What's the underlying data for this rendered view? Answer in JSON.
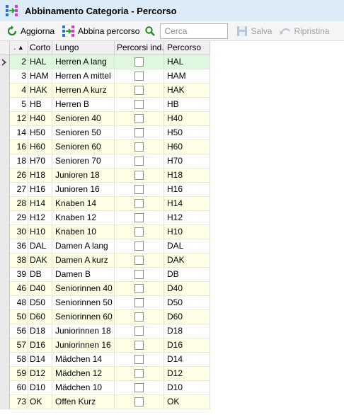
{
  "window": {
    "title": "Abbinamento Categoria - Percorso"
  },
  "toolbar": {
    "refresh_label": "Aggiorna",
    "match_label": "Abbina percorso",
    "search_placeholder": "Cerca",
    "save_label": "Salva",
    "restore_label": "Ripristina"
  },
  "table": {
    "columns": [
      ".",
      "Corto",
      "Lungo",
      "Percorsi ind.",
      "Percorso"
    ],
    "rows": [
      {
        "num": "2",
        "short": "HAL",
        "long": "Herren A lang",
        "percorso": "HAL"
      },
      {
        "num": "3",
        "short": "HAM",
        "long": "Herren A mittel",
        "percorso": "HAM"
      },
      {
        "num": "4",
        "short": "HAK",
        "long": "Herren A kurz",
        "percorso": "HAK"
      },
      {
        "num": "5",
        "short": "HB",
        "long": "Herren B",
        "percorso": "HB"
      },
      {
        "num": "12",
        "short": "H40",
        "long": "Senioren 40",
        "percorso": "H40"
      },
      {
        "num": "14",
        "short": "H50",
        "long": "Senioren 50",
        "percorso": "H50"
      },
      {
        "num": "16",
        "short": "H60",
        "long": "Senioren 60",
        "percorso": "H60"
      },
      {
        "num": "18",
        "short": "H70",
        "long": "Senioren 70",
        "percorso": "H70"
      },
      {
        "num": "26",
        "short": "H18",
        "long": "Junioren 18",
        "percorso": "H18"
      },
      {
        "num": "27",
        "short": "H16",
        "long": "Junioren 16",
        "percorso": "H16"
      },
      {
        "num": "28",
        "short": "H14",
        "long": "Knaben 14",
        "percorso": "H14"
      },
      {
        "num": "29",
        "short": "H12",
        "long": "Knaben 12",
        "percorso": "H12"
      },
      {
        "num": "30",
        "short": "H10",
        "long": "Knaben 10",
        "percorso": "H10"
      },
      {
        "num": "36",
        "short": "DAL",
        "long": "Damen A lang",
        "percorso": "DAL"
      },
      {
        "num": "38",
        "short": "DAK",
        "long": "Damen A kurz",
        "percorso": "DAK"
      },
      {
        "num": "39",
        "short": "DB",
        "long": "Damen B",
        "percorso": "DB"
      },
      {
        "num": "46",
        "short": "D40",
        "long": "Seniorinnen 40",
        "percorso": "D40"
      },
      {
        "num": "48",
        "short": "D50",
        "long": "Seniorinnen 50",
        "percorso": "D50"
      },
      {
        "num": "50",
        "short": "D60",
        "long": "Seniorinnen 60",
        "percorso": "D60"
      },
      {
        "num": "56",
        "short": "D18",
        "long": "Juniorinnen 18",
        "percorso": "D18"
      },
      {
        "num": "57",
        "short": "D16",
        "long": "Juniorinnen 16",
        "percorso": "D16"
      },
      {
        "num": "58",
        "short": "D14",
        "long": "Mädchen 14",
        "percorso": "D14"
      },
      {
        "num": "59",
        "short": "D12",
        "long": "Mädchen 12",
        "percorso": "D12"
      },
      {
        "num": "60",
        "short": "D10",
        "long": "Mädchen 10",
        "percorso": "D10"
      },
      {
        "num": "73",
        "short": "OK",
        "long": "Offen Kurz",
        "percorso": "OK"
      }
    ]
  }
}
